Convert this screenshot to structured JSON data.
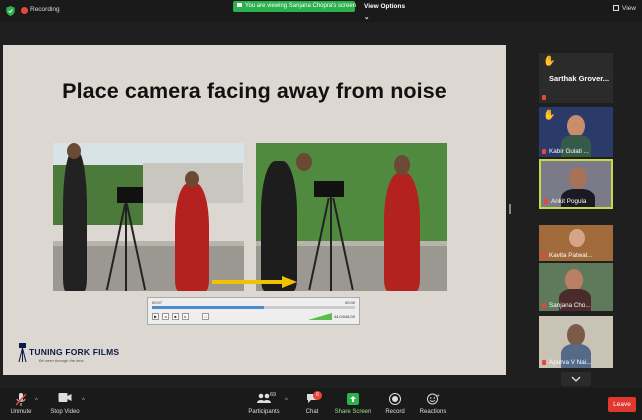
{
  "topbar": {
    "recording_label": "Recording",
    "viewing_banner": "You are viewing Sanjana Chopra's screen",
    "view_options_label": "View Options",
    "view_label": "View"
  },
  "slide": {
    "title": "Place camera facing away from noise",
    "logo_text": "TUNING FORK FILMS",
    "logo_tagline": "Be seen through the lens"
  },
  "player": {
    "time_current": "00:07",
    "time_total": "00:00",
    "zoom": "44.0/048.00",
    "progress": 0.55
  },
  "participants": [
    {
      "name": "Sarthak Grover...",
      "raised_hand": true,
      "has_video": false
    },
    {
      "name": "Kabir Gulati ...",
      "raised_hand": true,
      "has_video": true
    },
    {
      "name": "Ankit Pogula",
      "raised_hand": false,
      "has_video": true,
      "active_speaker": true
    },
    {
      "name": "Kavita Patwal...",
      "raised_hand": false,
      "has_video": true
    },
    {
      "name": "Sanjana Cho...",
      "raised_hand": false,
      "has_video": true
    },
    {
      "name": "Apurva V Nai...",
      "raised_hand": false,
      "has_video": true
    }
  ],
  "toolbar": {
    "unmute_label": "Unmute",
    "stop_video_label": "Stop Video",
    "participants_label": "Participants",
    "participants_count": "69",
    "chat_label": "Chat",
    "chat_badge": "6",
    "share_screen_label": "Share Screen",
    "record_label": "Record",
    "reactions_label": "Reactions",
    "leave_label": "Leave"
  },
  "colors": {
    "share_green": "#2bb24c",
    "leave_red": "#e0372e",
    "active_border": "#c8d84a",
    "slide_bg": "#dcd7d1"
  }
}
